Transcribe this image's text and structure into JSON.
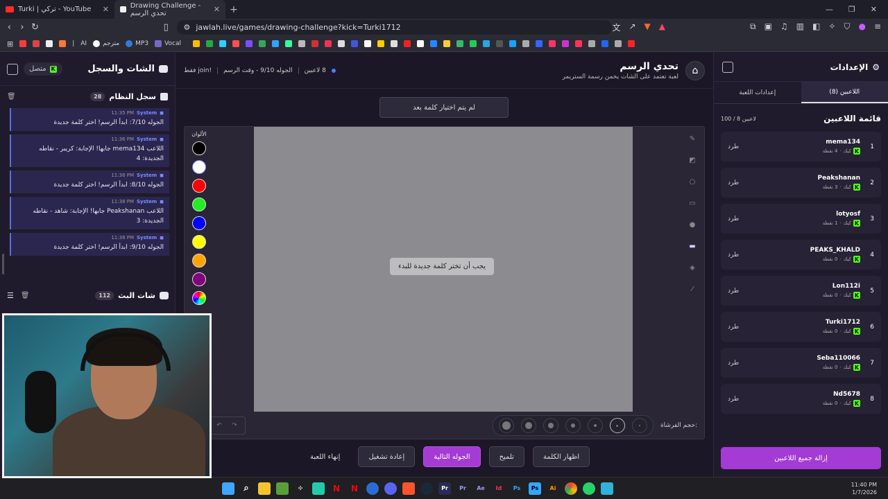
{
  "browser": {
    "tabs": [
      {
        "label": "Turki | تركي - YouTube",
        "active": false
      },
      {
        "label": "Drawing Challenge - تحدي الرسم",
        "active": true
      }
    ],
    "url": "jawlah.live/games/drawing-challenge?kick=Turki1712",
    "bookmarks": [
      "AI",
      "مترجم",
      "MP3",
      "Vocal"
    ],
    "bookmark_colors": [
      "#ff3b3b",
      "#d44",
      "#eee",
      "#ff7733",
      "#7c4dff",
      "#34a853",
      "#33ccff",
      "#ff4d4d",
      "#fbbc05",
      "#22aa44",
      "#2ea3ff",
      "#33ff99",
      "#bbbbbb",
      "#cc3333",
      "#ee3355",
      "#dddddd",
      "#4455dd",
      "#ffffff",
      "#ffcc00",
      "#dddddd",
      "#ee2222",
      "#ffffff",
      "#2288ff",
      "#ffcc33",
      "#33bb66",
      "#22cc55",
      "#2ba4e0",
      "#555555",
      "#1da1f2",
      "#aaaaaa",
      "#3366ff",
      "#ff3366",
      "#cc33cc",
      "#ff3355",
      "#aaaaaa",
      "#2266ee",
      "#aaaaaa",
      "#ff2222"
    ]
  },
  "left_panel": {
    "title": "الشات والسجل",
    "online": "متصل",
    "system_log": {
      "title": "سجل النظام",
      "count": "28",
      "items": [
        {
          "sender": "System",
          "time": "11:35 PM",
          "text": "الجوله 7/10: ابدأ الرسم! اختر كلمة جديدة"
        },
        {
          "sender": "System",
          "time": "11:36 PM",
          "text": "اللاعب mema134 جابها! الإجابة: كريبر - نقاطه الجديدة: 4"
        },
        {
          "sender": "System",
          "time": "11:36 PM",
          "text": "الجوله 8/10: ابدأ الرسم! اختر كلمة جديدة"
        },
        {
          "sender": "System",
          "time": "11:38 PM",
          "text": "اللاعب Peakshanan جابها! الإجابة: شاهد - نقاطه الجديدة: 3"
        },
        {
          "sender": "System",
          "time": "11:38 PM",
          "text": "الجوله 9/10: ابدأ الرسم! اختر كلمة جديدة"
        }
      ]
    },
    "stream_chat": {
      "title": "شات البث",
      "count": "112"
    }
  },
  "center": {
    "title": "تحدي الرسم",
    "subtitle": "لعبة تعتمد على الشات يخمن رسمة الستريمر",
    "players_count": "8 لاعبين",
    "round": "الجوله 9/10 - وقت الرسم",
    "join_hint": "!join فقط",
    "word_status": "لم يتم اختيار كلمة بعد",
    "canvas_message": "يجب أن تختر كلمة جديدة للبدء",
    "colors_label": "الألوان",
    "colors": [
      "#000000",
      "#ffffff",
      "#ff0000",
      "#22ee22",
      "#0000ff",
      "#ffff00",
      "#ffa500",
      "#800080"
    ],
    "brush_size_label": "حجم الفرشاة:",
    "brush_sizes": [
      2,
      3,
      4,
      6,
      8,
      10,
      12
    ],
    "selected_brush_index": 1,
    "actions": {
      "reveal": "اظهار الكلمة",
      "hint": "تلميح",
      "next_round": "الجوله التالية",
      "restart": "إعادة تشغيل",
      "end_game": "إنهاء اللعبة"
    }
  },
  "right_panel": {
    "title": "الإعدادات",
    "tabs": {
      "players": "اللاعبين (8)",
      "game_settings": "إعدادات اللعبة"
    },
    "list_title": "قائمة اللاعبين",
    "list_count": "100 / 8 لاعبين",
    "kick_label": "طرد",
    "platform": "كيك",
    "players": [
      {
        "rank": "1",
        "name": "mema134",
        "points": "4 نقطة"
      },
      {
        "rank": "2",
        "name": "Peakshanan",
        "points": "3 نقطة"
      },
      {
        "rank": "3",
        "name": "lotyosf",
        "points": "1 نقطة"
      },
      {
        "rank": "4",
        "name": "PEAKS_KHALD",
        "points": "0 نقطة"
      },
      {
        "rank": "5",
        "name": "Lon112i",
        "points": "0 نقطة"
      },
      {
        "rank": "6",
        "name": "Turki1712",
        "points": "0 نقطة"
      },
      {
        "rank": "7",
        "name": "Seba110066",
        "points": "0 نقطة"
      },
      {
        "rank": "8",
        "name": "Nd5678",
        "points": "0 نقطة"
      }
    ],
    "remove_all": "إزالة جميع اللاعبين"
  },
  "taskbar": {
    "time": "11:40 PM",
    "date": "1/7/2026",
    "icon_labels": [
      "Pr",
      "Ae",
      "Id",
      "Ps",
      "Ps",
      "Ai"
    ]
  }
}
